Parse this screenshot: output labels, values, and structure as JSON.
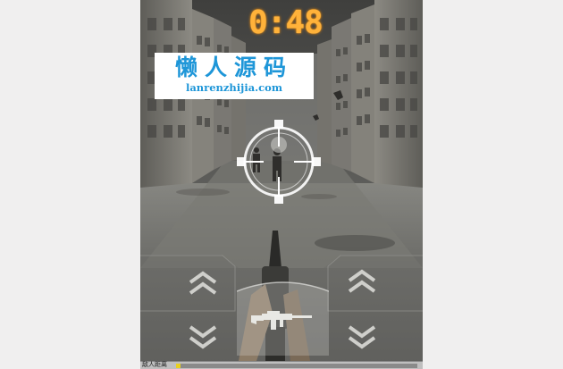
{
  "hud": {
    "timer": "0:48"
  },
  "watermark": {
    "title": "懒人源码",
    "url": "lanrenzhijia.com"
  },
  "controls": {
    "left_up": "chevron-up-icon",
    "left_down": "chevron-down-icon",
    "right_up": "chevron-up-icon",
    "right_down": "chevron-down-icon",
    "fire": "rifle-icon"
  },
  "statusbar": {
    "label": "敌人距离",
    "progress": 0.01
  },
  "colors": {
    "timer": "#ffb23a",
    "watermark_text": "#1e96d8",
    "health": "#e8d020"
  }
}
